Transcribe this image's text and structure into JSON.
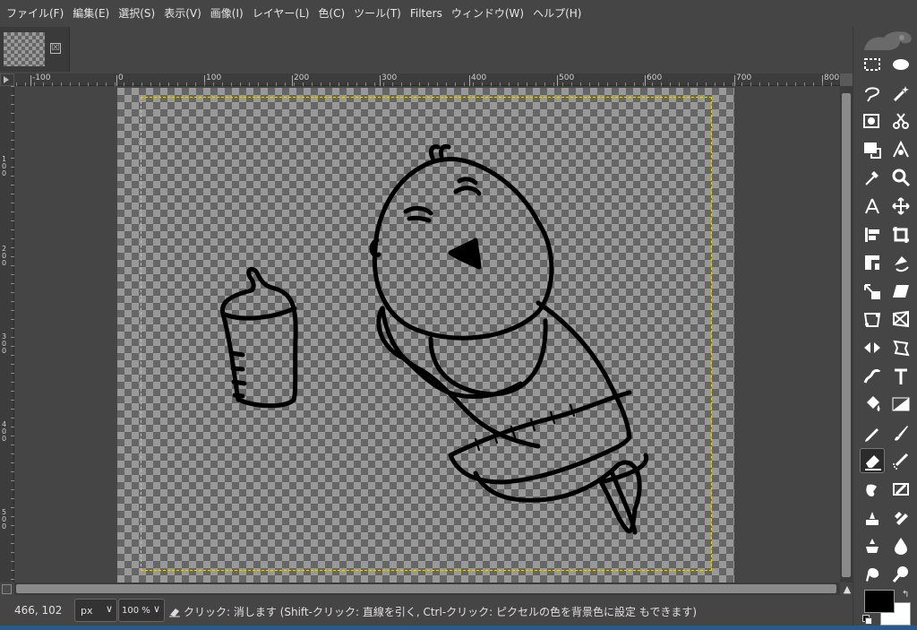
{
  "menubar": {
    "items": [
      {
        "label": "ファイル(F)"
      },
      {
        "label": "編集(E)"
      },
      {
        "label": "選択(S)"
      },
      {
        "label": "表示(V)"
      },
      {
        "label": "画像(I)"
      },
      {
        "label": "レイヤー(L)"
      },
      {
        "label": "色(C)"
      },
      {
        "label": "ツール(T)"
      },
      {
        "label": "Filters"
      },
      {
        "label": "ウィンドウ(W)"
      },
      {
        "label": "ヘルプ(H)"
      }
    ]
  },
  "tabs": {
    "close_symbol": "☒"
  },
  "ruler": {
    "h_labels": [
      "-100",
      "0",
      "100",
      "200",
      "300",
      "400",
      "500",
      "600",
      "700",
      "800"
    ],
    "v_labels": [
      "1 0 0",
      "2 0 0",
      "3 0 0",
      "4 0 0",
      "5 0 0"
    ]
  },
  "statusbar": {
    "coords": "466, 102",
    "unit": "px",
    "zoom": "100 %",
    "hint": "クリック: 消します (Shift-クリック: 直線を引く, Ctrl-クリック: ピクセルの色を背景色に設定 もできます)"
  },
  "toolbox": {
    "tools": [
      {
        "name": "rect-select-tool-icon"
      },
      {
        "name": "ellipse-select-tool-icon"
      },
      {
        "name": "free-select-tool-icon"
      },
      {
        "name": "fuzzy-select-tool-icon"
      },
      {
        "name": "by-color-select-tool-icon"
      },
      {
        "name": "scissors-select-tool-icon"
      },
      {
        "name": "foreground-select-tool-icon"
      },
      {
        "name": "paths-tool-icon"
      },
      {
        "name": "color-picker-tool-icon"
      },
      {
        "name": "zoom-tool-icon"
      },
      {
        "name": "measure-tool-icon"
      },
      {
        "name": "move-tool-icon"
      },
      {
        "name": "align-tool-icon"
      },
      {
        "name": "crop-tool-icon"
      },
      {
        "name": "unified-transform-tool-icon"
      },
      {
        "name": "rotate-tool-icon"
      },
      {
        "name": "scale-tool-icon"
      },
      {
        "name": "shear-tool-icon"
      },
      {
        "name": "handle-transform-tool-icon"
      },
      {
        "name": "perspective-tool-icon"
      },
      {
        "name": "flip-tool-icon"
      },
      {
        "name": "cage-transform-tool-icon"
      },
      {
        "name": "warp-transform-tool-icon"
      },
      {
        "name": "text-tool-icon"
      },
      {
        "name": "bucket-fill-tool-icon"
      },
      {
        "name": "gradient-tool-icon"
      },
      {
        "name": "pencil-tool-icon"
      },
      {
        "name": "paintbrush-tool-icon"
      },
      {
        "name": "eraser-tool-icon",
        "active": true
      },
      {
        "name": "airbrush-tool-icon"
      },
      {
        "name": "ink-tool-icon"
      },
      {
        "name": "mypaint-brush-tool-icon"
      },
      {
        "name": "clone-tool-icon"
      },
      {
        "name": "heal-tool-icon"
      },
      {
        "name": "perspective-clone-tool-icon"
      },
      {
        "name": "blur-sharpen-tool-icon"
      },
      {
        "name": "smudge-tool-icon"
      },
      {
        "name": "dodge-burn-tool-icon"
      }
    ],
    "fg_color": "#000000",
    "bg_color": "#ffffff"
  }
}
